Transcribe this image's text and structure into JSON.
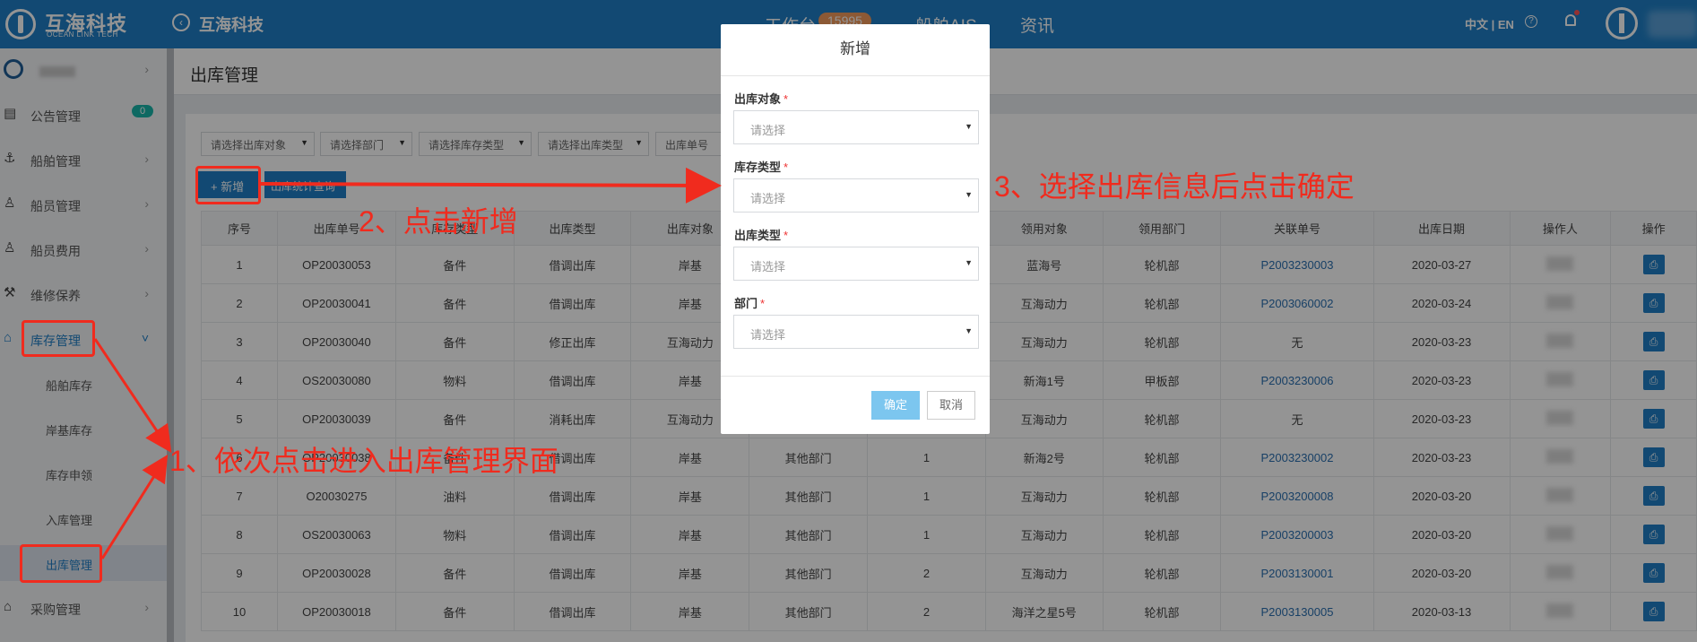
{
  "header": {
    "brand_cn": "互海科技",
    "brand_en": "OCEAN LINK TECH",
    "company": "互海科技",
    "nav": [
      {
        "label": "工作台",
        "badge": "15995"
      },
      {
        "label": "船舶AIS"
      },
      {
        "label": "资讯"
      }
    ],
    "language": "中文 | EN"
  },
  "sidebar": {
    "items": [
      {
        "label": "公告管理",
        "badge": "0"
      },
      {
        "label": "船舶管理"
      },
      {
        "label": "船员管理"
      },
      {
        "label": "船员费用"
      },
      {
        "label": "维修保养"
      },
      {
        "label": "库存管理"
      },
      {
        "label": "采购管理"
      }
    ],
    "sub_items": [
      "船舶库存",
      "岸基库存",
      "库存申领",
      "入库管理",
      "出库管理"
    ]
  },
  "page": {
    "title": "出库管理",
    "filters": [
      "请选择出库对象",
      "请选择部门",
      "请选择库存类型",
      "请选择出库类型",
      "出库单号"
    ],
    "add_button": "+ 新增",
    "stats_button": "出库统计查询"
  },
  "table": {
    "columns": [
      "序号",
      "出库单号",
      "库存类型",
      "出库类型",
      "出库对象",
      "",
      "",
      "领用对象",
      "领用部门",
      "关联单号",
      "出库日期",
      "操作人",
      "操作"
    ],
    "rows": [
      [
        "1",
        "OP20030053",
        "备件",
        "借调出库",
        "岸基",
        "",
        "",
        "蓝海号",
        "轮机部",
        "P2003230003",
        "2020-03-27"
      ],
      [
        "2",
        "OP20030041",
        "备件",
        "借调出库",
        "岸基",
        "",
        "",
        "互海动力",
        "轮机部",
        "P2003060002",
        "2020-03-24"
      ],
      [
        "3",
        "OP20030040",
        "备件",
        "修正出库",
        "互海动力",
        "",
        "",
        "互海动力",
        "轮机部",
        "无",
        "2020-03-23"
      ],
      [
        "4",
        "OS20030080",
        "物料",
        "借调出库",
        "岸基",
        "",
        "",
        "新海1号",
        "甲板部",
        "P2003230006",
        "2020-03-23"
      ],
      [
        "5",
        "OP20030039",
        "备件",
        "消耗出库",
        "互海动力",
        "",
        "",
        "互海动力",
        "轮机部",
        "无",
        "2020-03-23"
      ],
      [
        "6",
        "OP20030038",
        "备件",
        "借调出库",
        "岸基",
        "其他部门",
        "1",
        "新海2号",
        "轮机部",
        "P2003230002",
        "2020-03-23"
      ],
      [
        "7",
        "O20030275",
        "油料",
        "借调出库",
        "岸基",
        "其他部门",
        "1",
        "互海动力",
        "轮机部",
        "P2003200008",
        "2020-03-20"
      ],
      [
        "8",
        "OS20030063",
        "物料",
        "借调出库",
        "岸基",
        "其他部门",
        "1",
        "互海动力",
        "轮机部",
        "P2003200003",
        "2020-03-20"
      ],
      [
        "9",
        "OP20030028",
        "备件",
        "借调出库",
        "岸基",
        "其他部门",
        "2",
        "互海动力",
        "轮机部",
        "P2003130001",
        "2020-03-20"
      ],
      [
        "10",
        "OP20030018",
        "备件",
        "借调出库",
        "岸基",
        "其他部门",
        "2",
        "海洋之星5号",
        "轮机部",
        "P2003130005",
        "2020-03-13"
      ]
    ]
  },
  "modal": {
    "title": "新增",
    "fields": [
      {
        "label": "出库对象",
        "placeholder": "请选择"
      },
      {
        "label": "库存类型",
        "placeholder": "请选择"
      },
      {
        "label": "出库类型",
        "placeholder": "请选择"
      },
      {
        "label": "部门",
        "placeholder": "请选择"
      }
    ],
    "required_mark": "*",
    "ok": "确定",
    "cancel": "取消"
  },
  "annotations": {
    "step1": "1、依次点击进入出库管理界面",
    "step2": "2、点击新增",
    "step3": "3、选择出库信息后点击确定"
  },
  "colors": {
    "primary": "#1f7fc6",
    "annotation": "#f02b1e",
    "ok_button": "#7cc6ef"
  }
}
